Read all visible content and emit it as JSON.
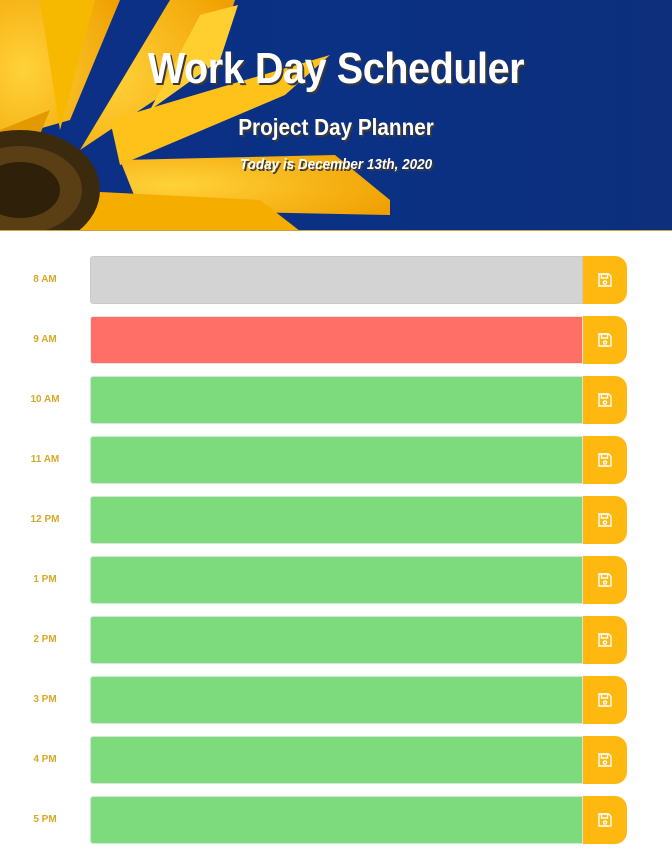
{
  "header": {
    "title": "Work Day Scheduler",
    "subtitle": "Project Day Planner",
    "date_line": "Today is December 13th, 2020"
  },
  "colors": {
    "past": "#d3d3d3",
    "present": "#ff6f67",
    "future": "#7ddb7d",
    "save_button": "#ffb80f",
    "hour_label": "#d8a82a",
    "header_background": "#0a3184"
  },
  "save_icon": "floppy-disk-icon",
  "timeblocks": [
    {
      "hour": "8 AM",
      "state": "past",
      "text": ""
    },
    {
      "hour": "9 AM",
      "state": "present",
      "text": ""
    },
    {
      "hour": "10 AM",
      "state": "future",
      "text": ""
    },
    {
      "hour": "11 AM",
      "state": "future",
      "text": ""
    },
    {
      "hour": "12 PM",
      "state": "future",
      "text": ""
    },
    {
      "hour": "1 PM",
      "state": "future",
      "text": ""
    },
    {
      "hour": "2 PM",
      "state": "future",
      "text": ""
    },
    {
      "hour": "3 PM",
      "state": "future",
      "text": ""
    },
    {
      "hour": "4 PM",
      "state": "future",
      "text": ""
    },
    {
      "hour": "5 PM",
      "state": "future",
      "text": ""
    }
  ]
}
